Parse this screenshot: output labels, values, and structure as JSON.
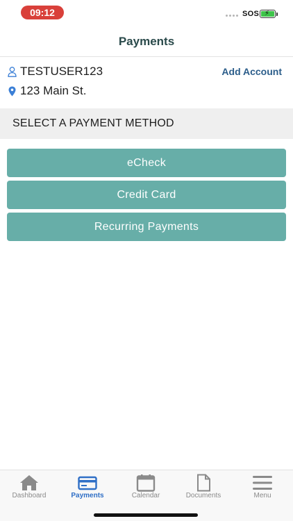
{
  "status_bar": {
    "time": "09:12",
    "carrier": "SOS",
    "battery_level": 1.0,
    "accent": "#d9403a"
  },
  "header": {
    "title": "Payments"
  },
  "account": {
    "username": "TESTUSER123",
    "address": "123 Main St.",
    "add_account_label": "Add Account",
    "user_icon": "person-icon",
    "address_icon": "location-pin-icon"
  },
  "section": {
    "title": "SELECT A PAYMENT METHOD"
  },
  "payment_methods": [
    {
      "label": "eCheck"
    },
    {
      "label": "Credit Card"
    },
    {
      "label": "Recurring Payments"
    }
  ],
  "tab_bar": {
    "items": [
      {
        "label": "Dashboard",
        "icon": "home-icon",
        "active": false
      },
      {
        "label": "Payments",
        "icon": "credit-card-icon",
        "active": true
      },
      {
        "label": "Calendar",
        "icon": "calendar-icon",
        "active": false
      },
      {
        "label": "Documents",
        "icon": "document-icon",
        "active": false
      },
      {
        "label": "Menu",
        "icon": "hamburger-menu-icon",
        "active": false
      }
    ]
  },
  "colors": {
    "button": "#67aea8",
    "active_tab": "#2f6fc6",
    "inactive_tab": "#8a8a8a",
    "link": "#2b5d8a"
  }
}
